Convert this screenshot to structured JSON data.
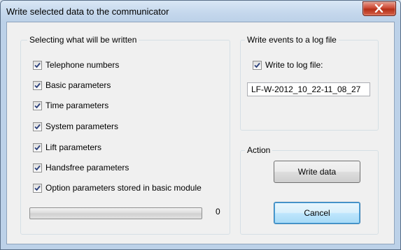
{
  "window": {
    "title": "Write selected data to the communicator"
  },
  "left_group": {
    "label": "Selecting what will be written",
    "items": [
      {
        "label": "Telephone numbers",
        "checked": true
      },
      {
        "label": "Basic parameters",
        "checked": true
      },
      {
        "label": "Time parameters",
        "checked": true
      },
      {
        "label": "System parameters",
        "checked": true
      },
      {
        "label": "Lift parameters",
        "checked": true
      },
      {
        "label": "Handsfree parameters",
        "checked": true
      },
      {
        "label": "Option parameters stored in basic module",
        "checked": true
      }
    ],
    "progress": {
      "value_label": "0",
      "fraction": 0
    }
  },
  "log_group": {
    "label": "Write events to a log file",
    "checkbox_label": "Write to log file:",
    "checked": true,
    "filename": "LF-W-2012_10_22-11_08_27"
  },
  "action_group": {
    "label": "Action",
    "write_button": "Write data",
    "cancel_button": "Cancel"
  }
}
